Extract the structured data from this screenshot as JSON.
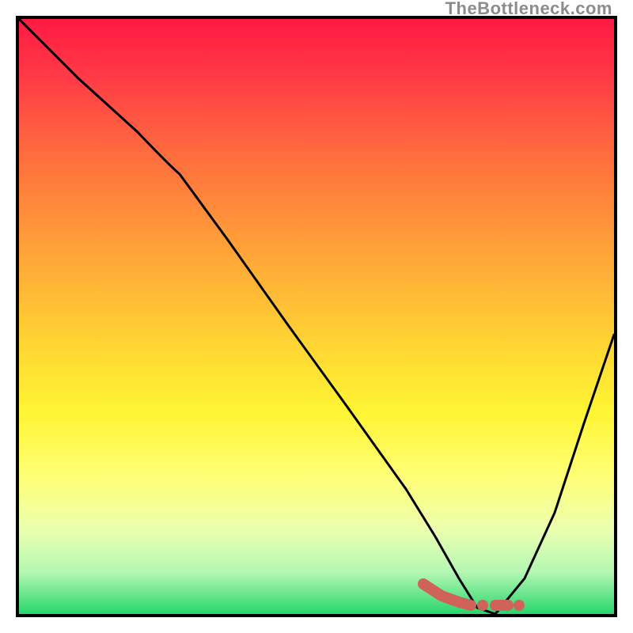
{
  "attribution": "TheBottleneck.com",
  "chart_data": {
    "type": "line",
    "title": "",
    "xlabel": "",
    "ylabel": "",
    "xlim": [
      0,
      100
    ],
    "ylim": [
      0,
      100
    ],
    "grid": false,
    "legend": false,
    "series": [
      {
        "name": "main-curve",
        "color": "#000000",
        "x": [
          0,
          10,
          20,
          27,
          35,
          45,
          55,
          65,
          70,
          74,
          77,
          80,
          85,
          90,
          95,
          100
        ],
        "y": [
          100,
          90,
          81,
          74,
          63,
          49,
          35,
          21,
          13,
          6,
          1,
          0,
          6,
          17,
          32,
          47
        ]
      },
      {
        "name": "marker-segment",
        "color": "#d0625c",
        "x": [
          68,
          71,
          74,
          76,
          78,
          80,
          82,
          84
        ],
        "y": [
          5,
          3,
          2,
          1.5,
          1.5,
          1.5,
          1.5,
          1.5
        ]
      }
    ],
    "annotations": []
  }
}
